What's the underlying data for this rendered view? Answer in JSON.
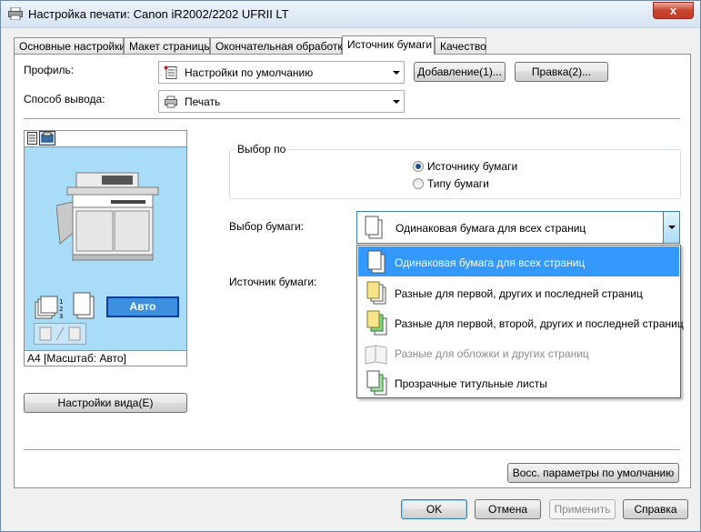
{
  "window": {
    "title": "Настройка печати: Canon iR2002/2202 UFRII LT",
    "close_label": "x"
  },
  "tabs": [
    {
      "label": "Основные настройки"
    },
    {
      "label": "Макет страницы"
    },
    {
      "label": "Окончательная обработка"
    },
    {
      "label": "Источник бумаги"
    },
    {
      "label": "Качество"
    }
  ],
  "profile": {
    "label": "Профиль:",
    "value": "Настройки по умолчанию",
    "add_button": "Добавление(1)...",
    "edit_button": "Правка(2)..."
  },
  "output": {
    "label": "Способ вывода:",
    "value": "Печать"
  },
  "preview": {
    "caption": "А4 [Масштаб: Авто]",
    "auto_button": "Авто",
    "view_settings_button": "Настройки вида(E)"
  },
  "selection": {
    "group_label": "Выбор по",
    "options": [
      "Источнику бумаги",
      "Типу бумаги"
    ],
    "checked_index": 0
  },
  "paper_select": {
    "label": "Выбор бумаги:",
    "value": "Одинаковая бумага для всех страниц",
    "items": [
      {
        "label": "Одинаковая бумага для всех страниц",
        "state": "selected"
      },
      {
        "label": "Разные для первой, других и последней страниц",
        "state": "normal"
      },
      {
        "label": "Разные для первой, второй, других и последней страниц",
        "state": "normal"
      },
      {
        "label": "Разные для обложки и других страниц",
        "state": "disabled"
      },
      {
        "label": "Прозрачные титульные листы",
        "state": "normal"
      }
    ]
  },
  "paper_source": {
    "label": "Источник бумаги:"
  },
  "restore_defaults_button": "Восс. параметры по умолчанию",
  "footer": {
    "ok": "OK",
    "cancel": "Отмена",
    "apply": "Применить",
    "help": "Справка"
  },
  "colors": {
    "selection": "#3399ff",
    "preview_bg": "#a8dcf7",
    "auto_button": "#3d8fe0"
  }
}
